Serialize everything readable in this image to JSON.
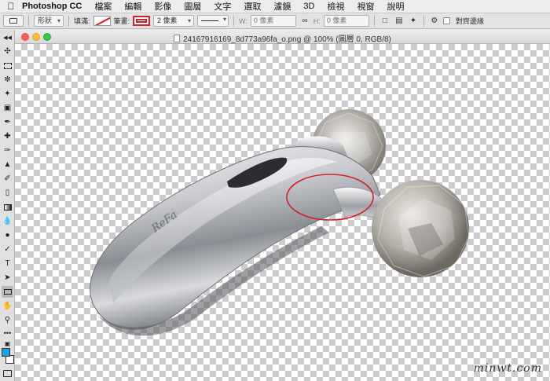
{
  "menubar": {
    "app_name": "Photoshop CC",
    "items": [
      "檔案",
      "編輯",
      "影像",
      "圖層",
      "文字",
      "選取",
      "濾鏡",
      "3D",
      "檢視",
      "視窗",
      "說明"
    ]
  },
  "options": {
    "mode": "形狀",
    "fill_label": "填滿:",
    "stroke_label": "筆畫:",
    "stroke_width": "2 像素",
    "w_label": "W:",
    "w_value": "0 像素",
    "h_label": "H:",
    "h_value": "0 像素",
    "align_edges_label": "對齊邊緣"
  },
  "document": {
    "title": "24167916169_8d773a96fa_o.png @ 100% (圖層 0, RGB/8)"
  },
  "product": {
    "logo_text": "ReFa"
  },
  "watermark": "minwt.com",
  "colors": {
    "stroke_red": "#d3202a",
    "foreground": "#1da1e2",
    "background": "#ffffff"
  },
  "icons": {
    "tools": [
      "move-icon",
      "marquee-icon",
      "lasso-icon",
      "magic-wand-icon",
      "crop-icon",
      "eyedropper-icon",
      "healing-icon",
      "brush-icon",
      "clone-stamp-icon",
      "history-brush-icon",
      "eraser-icon",
      "gradient-icon",
      "blur-icon",
      "dodge-icon",
      "pen-icon",
      "type-icon",
      "path-select-icon",
      "rectangle-icon",
      "hand-icon",
      "zoom-icon",
      "more-tools-icon"
    ]
  }
}
